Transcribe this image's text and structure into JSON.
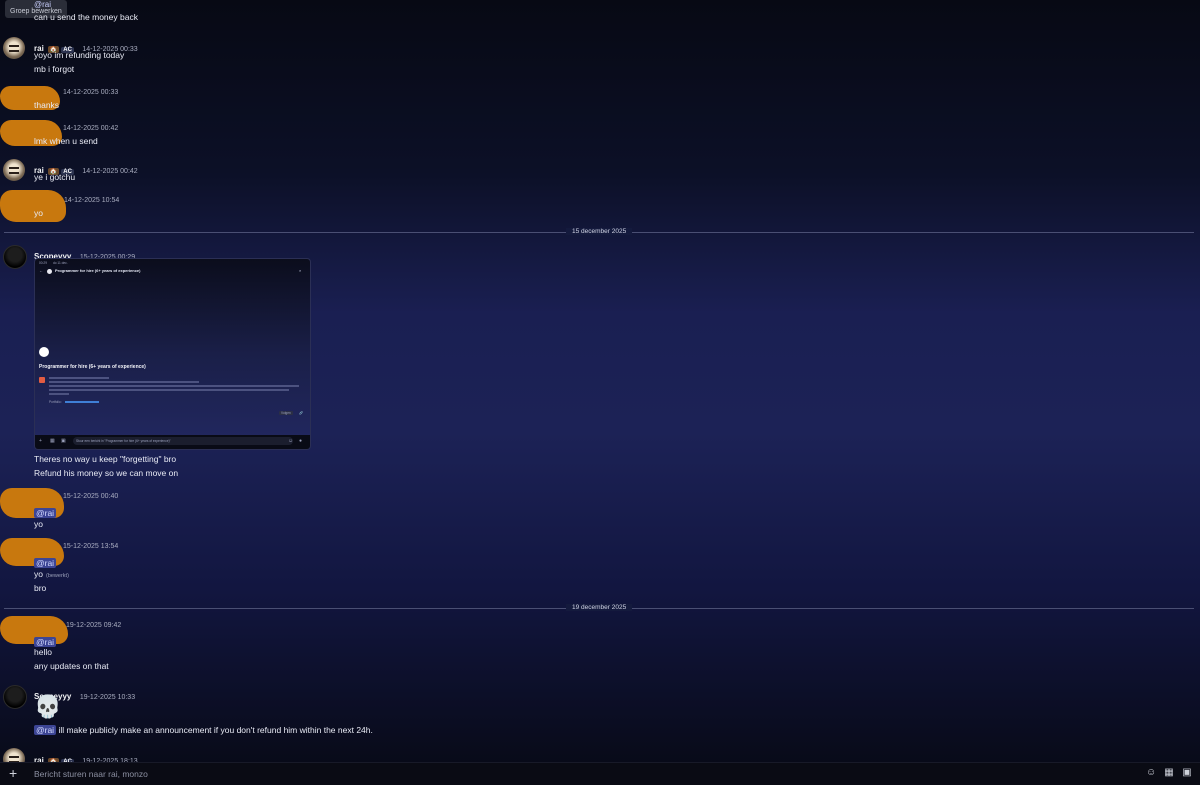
{
  "tooltip": "Groep bewerken",
  "top_mention": "@rai",
  "messages": [
    {
      "text": "can u send the money back"
    },
    {
      "user": "rai",
      "badge_emoji": "🏠",
      "badge_tag": "AC",
      "time": "14-12-2025 00:33",
      "lines": [
        "yoyo im refunding today",
        "mb i forgot"
      ]
    },
    {
      "time": "14-12-2025 00:33",
      "lines": [
        "thanks"
      ]
    },
    {
      "time": "14-12-2025 00:42",
      "lines": [
        "lmk when u send"
      ]
    },
    {
      "user": "rai",
      "badge_emoji": "🏠",
      "badge_tag": "AC",
      "time": "14-12-2025 00:42",
      "lines": [
        "ye i gotchu"
      ]
    },
    {
      "time": "14-12-2025 10:54",
      "lines": [
        "yo"
      ]
    },
    {
      "user": "Scopeyyy",
      "time": "15-12-2025 00:29",
      "lines": [
        "Theres no way u keep \"forgetting\" bro",
        "Refund his money so we can move on"
      ]
    },
    {
      "time": "15-12-2025 00:40",
      "mention": "@rai",
      "lines": [
        "yo"
      ]
    },
    {
      "time": "15-12-2025 13:54",
      "mention": "@rai",
      "lines": [
        "yo",
        "bro"
      ],
      "edited": "(bewerkt)"
    },
    {
      "time": "19-12-2025 09:42",
      "mention": "@rai",
      "lines": [
        "hello",
        "any updates on that"
      ]
    },
    {
      "user": "Scopeyyy",
      "time": "19-12-2025 10:33",
      "emoji": "💀",
      "mention": "@rai",
      "lines": [
        "ill make publicly make an announcement if you don't refund him within the next 24h."
      ]
    },
    {
      "user": "rai",
      "badge_emoji": "🏠",
      "badge_tag": "AC",
      "time": "19-12-2025 18:13"
    }
  ],
  "dividers": [
    "15 december 2025",
    "19 december 2025"
  ],
  "embed": {
    "header_time": "00:29",
    "header_date": "do 11 dec.",
    "thread_title": "Programmer for hire (6+ years of experience)",
    "reply_placeholder": "Stuur een bericht in \"Programmer for hire (6+ years of experience)\"",
    "portfolio_label": "Portfolio:",
    "follow_label": "Volgen"
  },
  "composer": {
    "placeholder": "Bericht sturen naar rai, monzo"
  },
  "colors": {
    "accent_blob": "#c8780e",
    "mention_bg": "#3c4595"
  }
}
